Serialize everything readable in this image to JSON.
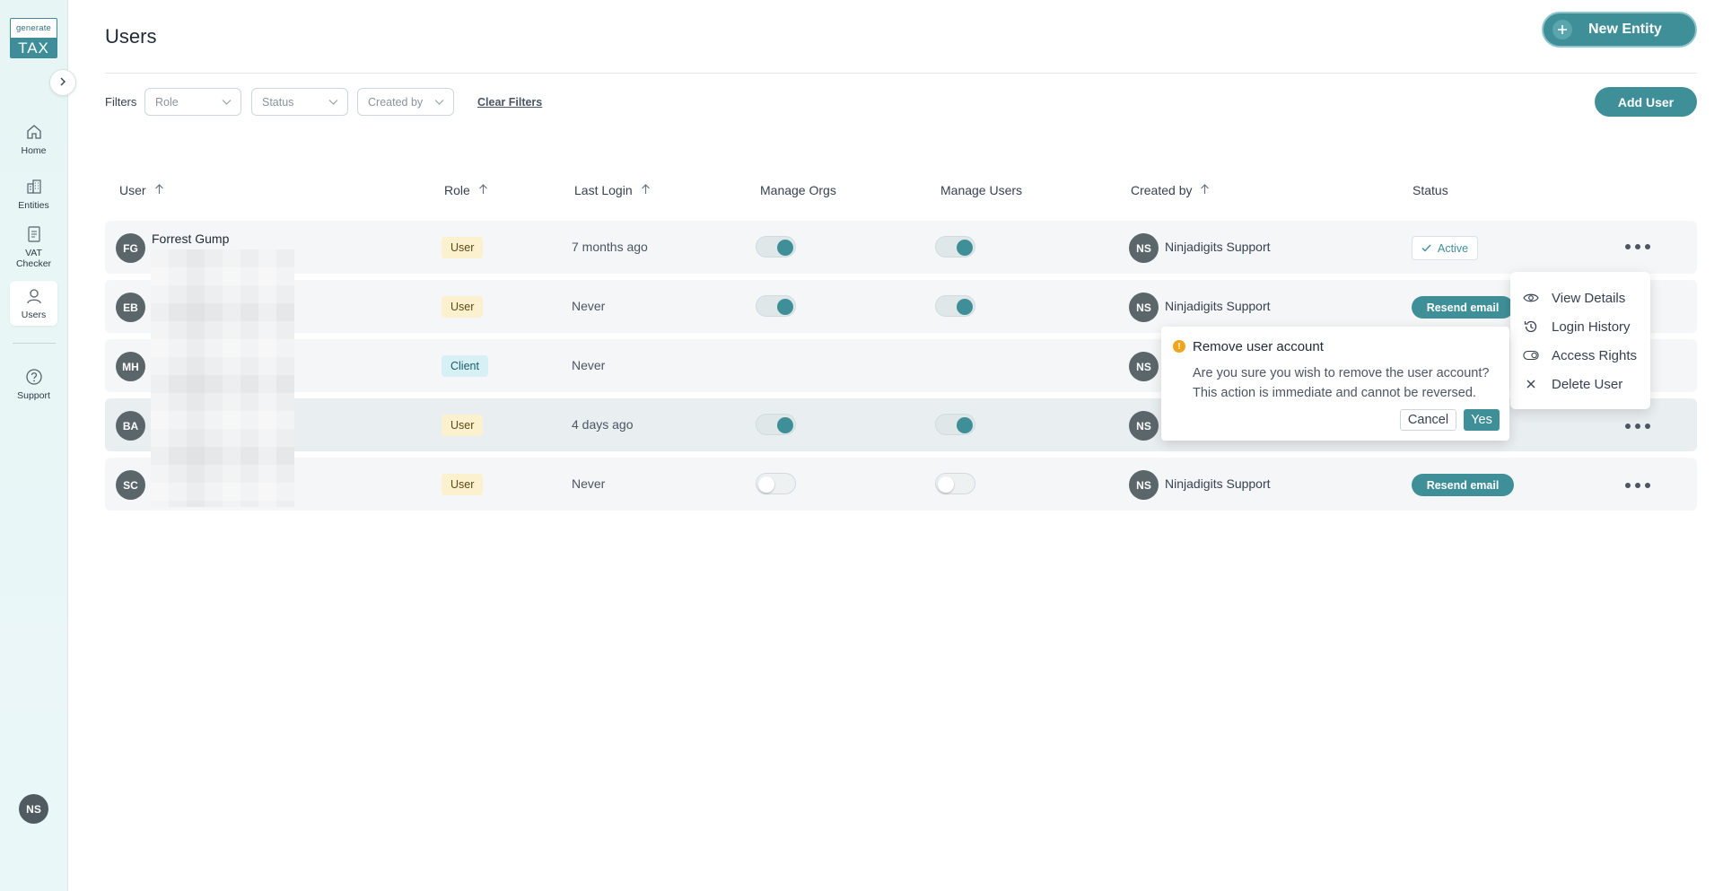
{
  "sidebar": {
    "logo_top": "generate",
    "logo_bottom": "TAX",
    "items": [
      {
        "label": "Home",
        "icon": "home-icon"
      },
      {
        "label": "Entities",
        "icon": "buildings-icon"
      },
      {
        "label": "VAT Checker",
        "icon": "document-icon"
      },
      {
        "label": "Users",
        "icon": "user-icon"
      },
      {
        "label": "Support",
        "icon": "help-circle-icon"
      }
    ],
    "user_initials": "NS"
  },
  "header": {
    "title": "Users",
    "new_entity_label": "New Entity"
  },
  "filters": {
    "label": "Filters",
    "role_placeholder": "Role",
    "status_placeholder": "Status",
    "created_by_placeholder": "Created by",
    "clear_label": "Clear Filters",
    "add_user_label": "Add User"
  },
  "table": {
    "columns": [
      "User",
      "Role",
      "Last Login",
      "Manage Orgs",
      "Manage Users",
      "Created by",
      "Status"
    ],
    "rows": [
      {
        "initials": "FG",
        "name": "Forrest Gump",
        "role": "User",
        "role_type": "user",
        "last_login": "7 months ago",
        "manage_orgs": true,
        "manage_users": true,
        "creator_initials": "NS",
        "creator": "Ninjadigits Support",
        "status": "Active",
        "status_type": "active"
      },
      {
        "initials": "EB",
        "name": "",
        "role": "User",
        "role_type": "user",
        "last_login": "Never",
        "manage_orgs": true,
        "manage_users": true,
        "creator_initials": "NS",
        "creator": "Ninjadigits Support",
        "status": "Resend email",
        "status_type": "resend"
      },
      {
        "initials": "MH",
        "name": "",
        "role": "Client",
        "role_type": "client",
        "last_login": "Never",
        "manage_orgs": null,
        "manage_users": null,
        "creator_initials": "NS",
        "creator": "",
        "status": "",
        "status_type": "none"
      },
      {
        "initials": "BA",
        "name": "",
        "role": "User",
        "role_type": "user",
        "last_login": "4 days ago",
        "manage_orgs": true,
        "manage_users": true,
        "creator_initials": "NS",
        "creator": "",
        "status": "",
        "status_type": "none"
      },
      {
        "initials": "SC",
        "name": "",
        "role": "User",
        "role_type": "user",
        "last_login": "Never",
        "manage_orgs": false,
        "manage_users": false,
        "creator_initials": "NS",
        "creator": "Ninjadigits Support",
        "status": "Resend email",
        "status_type": "resend"
      }
    ]
  },
  "context_menu": {
    "items": [
      {
        "label": "View Details",
        "icon": "eye-icon"
      },
      {
        "label": "Login History",
        "icon": "history-icon"
      },
      {
        "label": "Access Rights",
        "icon": "toggle-icon"
      },
      {
        "label": "Delete User",
        "icon": "close-icon"
      }
    ]
  },
  "confirm_dialog": {
    "title": "Remove user account",
    "message": "Are you sure you wish to remove the user account? This action is immediate and cannot be reversed.",
    "cancel_label": "Cancel",
    "yes_label": "Yes"
  },
  "colors": {
    "accent": "#3f8f99",
    "warning": "#f0a41c"
  }
}
